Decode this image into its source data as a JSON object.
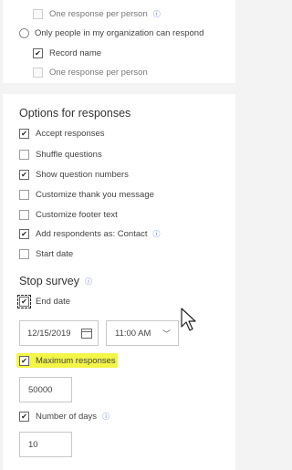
{
  "top_panel": {
    "one_response_label": "One response per person",
    "org_radio_label": "Only people in my organization can respond",
    "record_name_label": "Record name",
    "one_response_sub_label": "One response per person"
  },
  "options": {
    "heading": "Options for responses",
    "items": [
      {
        "label": "Accept responses",
        "checked": "✔"
      },
      {
        "label": "Shuffle questions",
        "checked": ""
      },
      {
        "label": "Show question numbers",
        "checked": "✔"
      },
      {
        "label": "Customize thank you message",
        "checked": ""
      },
      {
        "label": "Customize footer text",
        "checked": ""
      },
      {
        "label": "Add respondents as: Contact",
        "checked": "✔"
      },
      {
        "label": "Start date",
        "checked": ""
      }
    ]
  },
  "stop_survey": {
    "heading": "Stop survey",
    "end_date_label": "End date",
    "end_date_value": "12/15/2019",
    "end_time_value": "11:00 AM",
    "max_responses_label": "Maximum responses",
    "max_responses_value": "50000",
    "number_of_days_label": "Number of days",
    "number_of_days_value": "10"
  },
  "icons": {
    "info": "ⓘ",
    "check": "✔",
    "chevron": "﹀"
  },
  "colors": {
    "accent_teal": "#03787c",
    "highlight_yellow": "#f3f547",
    "info_blue": "#4a70c6"
  }
}
